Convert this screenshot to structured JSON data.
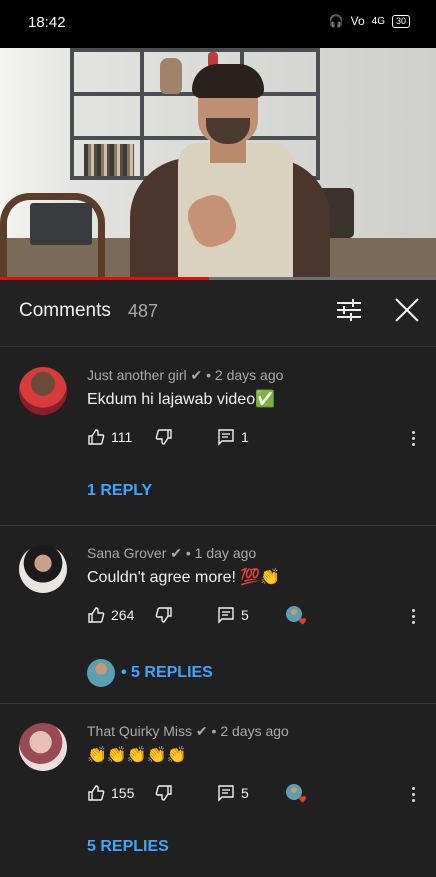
{
  "status_bar": {
    "time": "18:42",
    "network": "4G",
    "battery": "30"
  },
  "video": {
    "progress_fraction": 0.48
  },
  "comments_panel": {
    "title": "Comments",
    "count": "487"
  },
  "comments": [
    {
      "author": "Just another girl",
      "time": "• 2 days ago",
      "text": "Ekdum hi lajawab video",
      "text_emoji": "✅",
      "likes": "111",
      "replies_count": "1",
      "reply_link": "1 REPLY"
    },
    {
      "author": "Sana Grover",
      "time": "• 1 day ago",
      "text": "Couldn't agree more!",
      "text_emoji": "💯👏",
      "likes": "264",
      "replies_count": "5",
      "reply_link": "• 5 REPLIES"
    },
    {
      "author": "That Quirky Miss",
      "time": "• 2 days ago",
      "text": "",
      "text_emoji": "👏👏👏👏👏",
      "likes": "155",
      "replies_count": "5",
      "reply_link": "5 REPLIES"
    }
  ],
  "colors": {
    "background": "#202020",
    "link": "#3ea6ff",
    "progress": "#e10f0f"
  }
}
